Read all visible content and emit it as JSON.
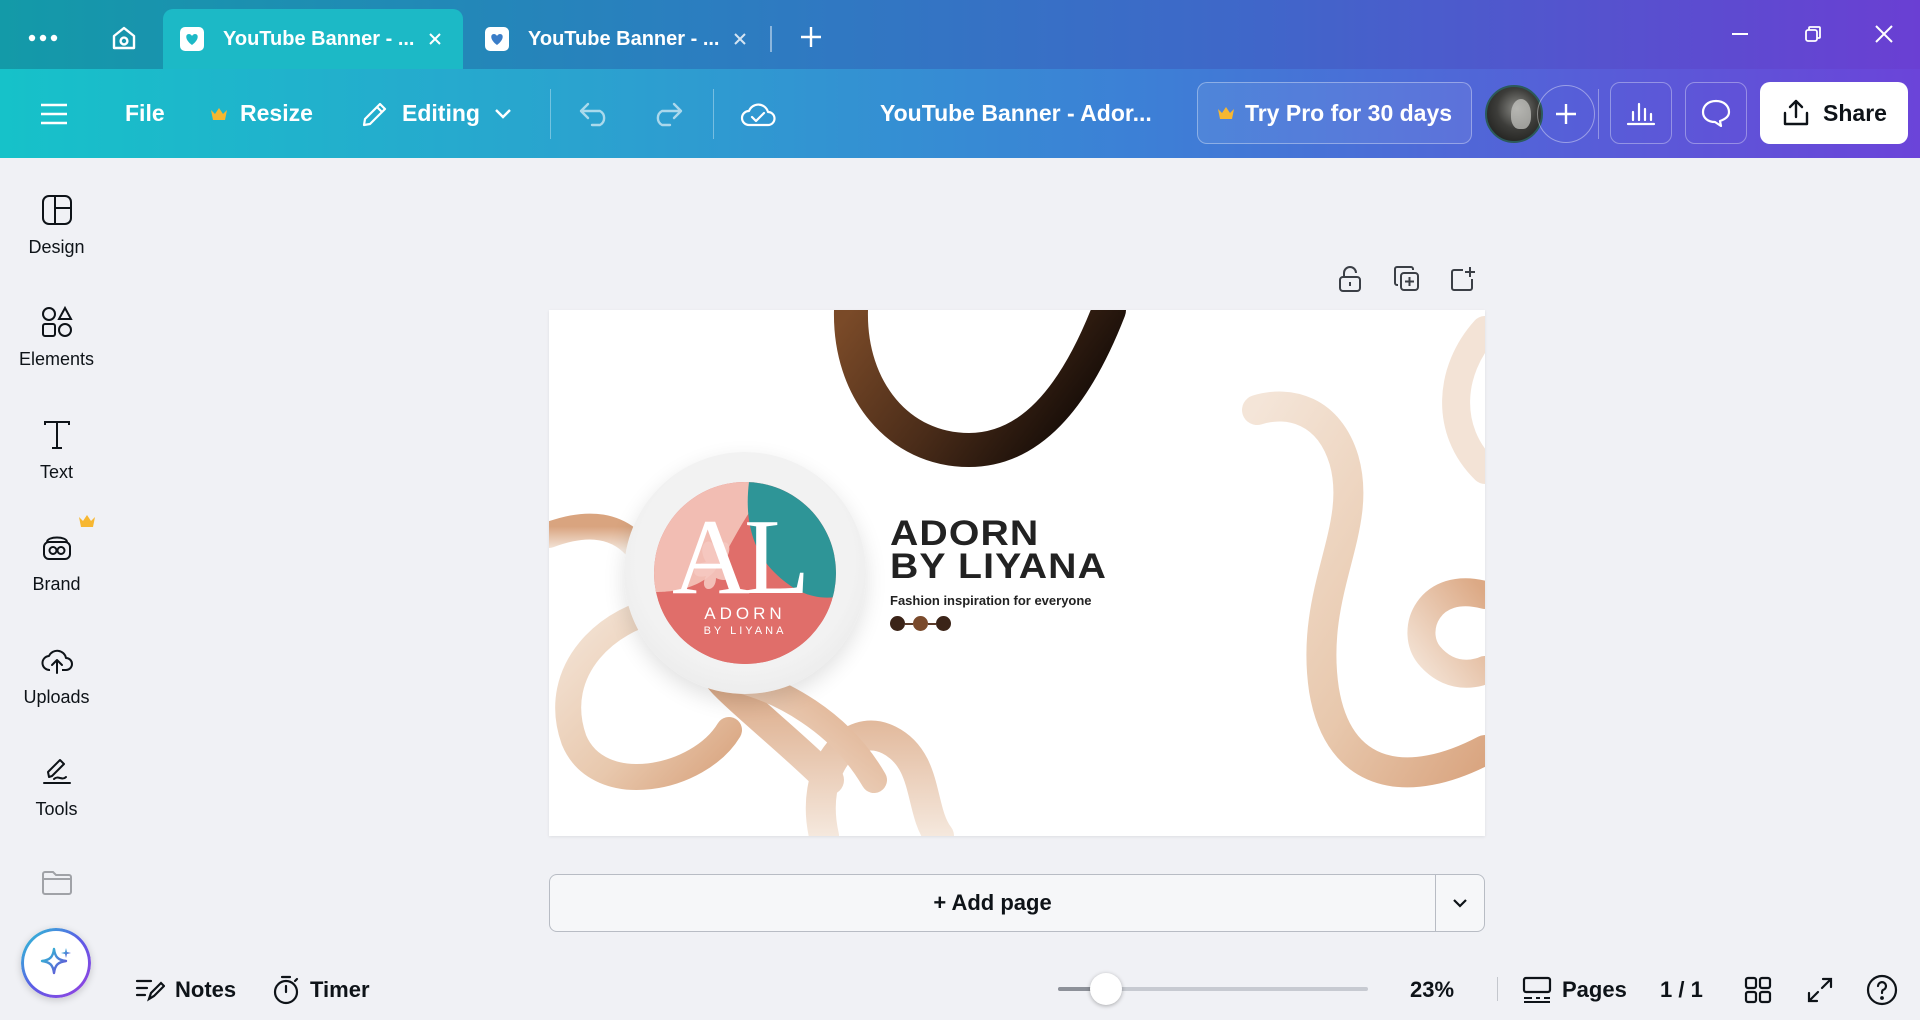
{
  "tabs": [
    {
      "title": "YouTube Banner - ...",
      "active": true
    },
    {
      "title": "YouTube Banner - ...",
      "active": false
    }
  ],
  "toolbar": {
    "file_label": "File",
    "resize_label": "Resize",
    "editing_label": "Editing",
    "doc_title": "YouTube Banner - Ador...",
    "pro_label": "Try Pro for 30 days",
    "share_label": "Share"
  },
  "sidebar": {
    "items": [
      {
        "label": "Design",
        "icon": "design-icon"
      },
      {
        "label": "Elements",
        "icon": "elements-icon"
      },
      {
        "label": "Text",
        "icon": "text-icon"
      },
      {
        "label": "Brand",
        "icon": "brand-icon"
      },
      {
        "label": "Uploads",
        "icon": "uploads-icon"
      },
      {
        "label": "Tools",
        "icon": "tools-icon"
      }
    ]
  },
  "design": {
    "logo_letters": "AL",
    "logo_name": "ADORN",
    "logo_sub": "BY LIYANA",
    "title_line1": "ADORN",
    "title_line2": "BY LIYANA",
    "tagline": "Fashion inspiration for everyone",
    "dot_colors": [
      "#3b2418",
      "#7a4a2c",
      "#3b2418"
    ]
  },
  "add_page_label": "+ Add page",
  "footer": {
    "notes_label": "Notes",
    "timer_label": "Timer",
    "zoom_label": "23%",
    "zoom_value": 0.23,
    "pages_label": "Pages",
    "page_count": "1 / 1"
  },
  "colors": {
    "accent_teal": "#1cb9c6",
    "accent_purple": "#6b44d9",
    "pro_crown": "#f7b731",
    "logo_coral": "#e06e6a",
    "logo_teal": "#2e9597",
    "logo_pink": "#f2bdb3"
  }
}
